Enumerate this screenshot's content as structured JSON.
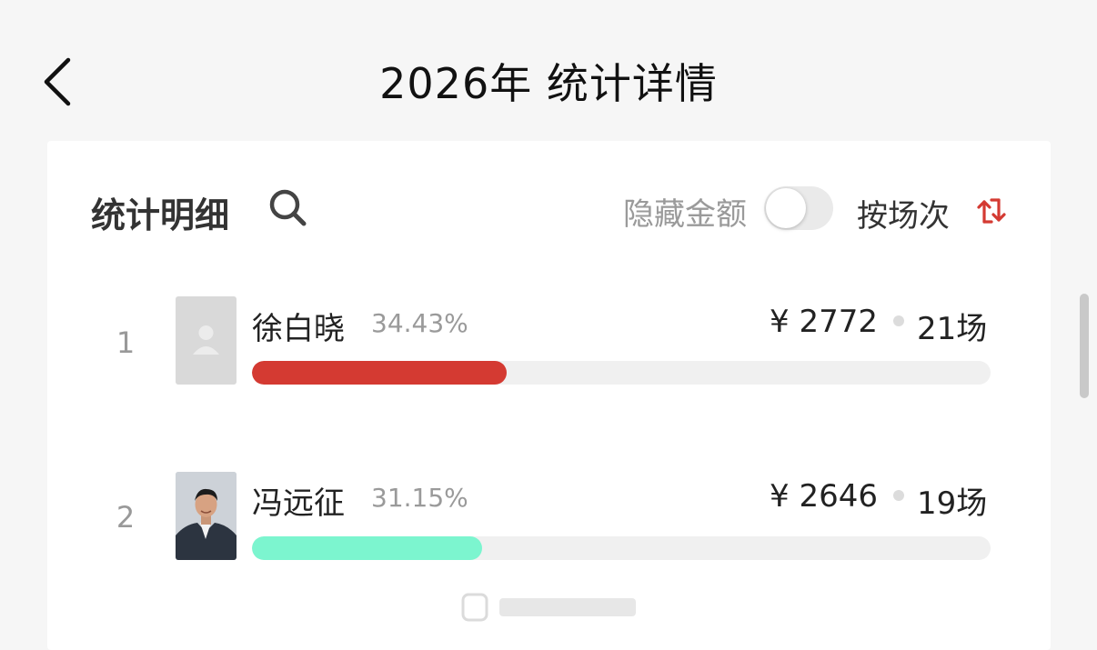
{
  "header": {
    "title": "2026年 统计详情"
  },
  "toolbar": {
    "section_title": "统计明细",
    "hide_amount_label": "隐藏金额",
    "hide_amount_on": false,
    "sort_label": "按场次"
  },
  "rows": [
    {
      "rank": "1",
      "name": "徐白晓",
      "percent": "34.43%",
      "amount": "¥ 2772",
      "count": "21场",
      "bar_fraction": 0.3443,
      "bar_color": "#d43a32",
      "avatar": "placeholder-avatar"
    },
    {
      "rank": "2",
      "name": "冯远征",
      "percent": "31.15%",
      "amount": "¥ 2646",
      "count": "19场",
      "bar_fraction": 0.3115,
      "bar_color": "#7cf5cf",
      "avatar": "photo-avatar"
    }
  ],
  "colors": {
    "accent": "#d43a32",
    "secondary_bar": "#7cf5cf"
  }
}
